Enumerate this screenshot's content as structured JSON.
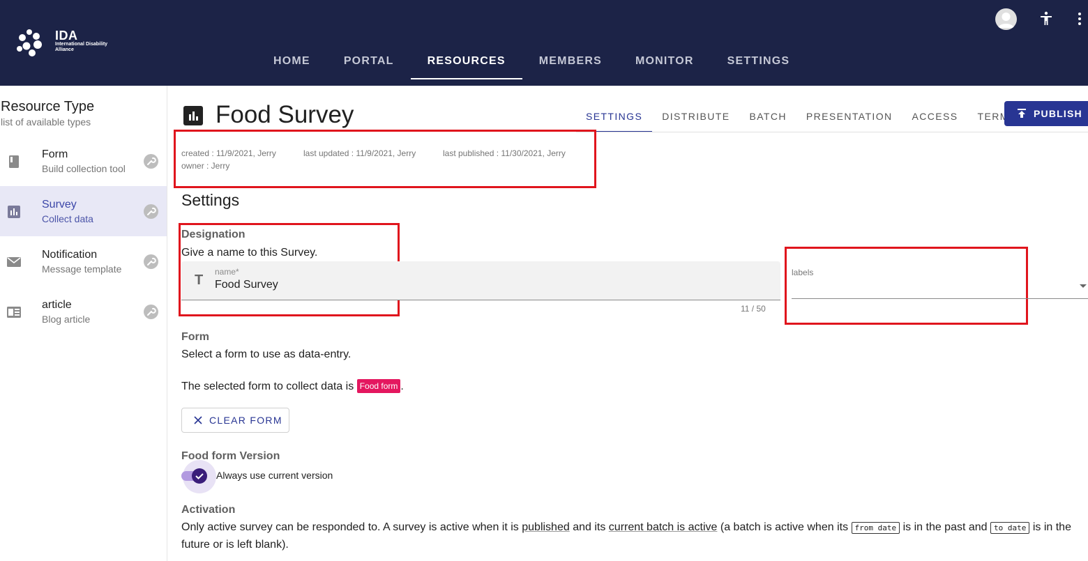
{
  "brand": {
    "name": "IDA",
    "subtitle": "International Disability Alliance"
  },
  "nav": {
    "items": [
      {
        "label": "HOME"
      },
      {
        "label": "PORTAL"
      },
      {
        "label": "RESOURCES"
      },
      {
        "label": "MEMBERS"
      },
      {
        "label": "MONITOR"
      },
      {
        "label": "SETTINGS"
      }
    ],
    "active": "RESOURCES"
  },
  "sidebar": {
    "title": "Resource Type",
    "subtitle": "list of available types",
    "items": [
      {
        "label": "Form",
        "description": "Build collection tool",
        "icon": "book-icon"
      },
      {
        "label": "Survey",
        "description": "Collect data",
        "icon": "bar-chart-icon"
      },
      {
        "label": "Notification",
        "description": "Message template",
        "icon": "envelope-icon"
      },
      {
        "label": "article",
        "description": "Blog article",
        "icon": "article-icon"
      }
    ],
    "active": "Survey"
  },
  "resource": {
    "title": "Food Survey",
    "tabs": [
      {
        "label": "SETTINGS"
      },
      {
        "label": "DISTRIBUTE"
      },
      {
        "label": "BATCH"
      },
      {
        "label": "PRESENTATION"
      },
      {
        "label": "ACCESS"
      },
      {
        "label": "TERMS"
      }
    ],
    "active_tab": "SETTINGS",
    "publish_label": "PUBLISH"
  },
  "meta": {
    "created": "created : 11/9/2021, Jerry",
    "last_updated": "last updated : 11/9/2021, Jerry",
    "last_published": "last published : 11/30/2021, Jerry",
    "owner": "owner : Jerry"
  },
  "settings": {
    "heading": "Settings",
    "designation": {
      "title": "Designation",
      "description": "Give a name to this Survey.",
      "name_label": "name*",
      "name_value": "Food Survey",
      "counter": "11 / 50",
      "labels_label": "labels"
    },
    "form": {
      "title": "Form",
      "description": "Select a form to use as data-entry.",
      "selected_prefix": "The selected form to collect data is",
      "selected_chip": "Food form",
      "selected_suffix": ".",
      "clear_label": "CLEAR FORM"
    },
    "version": {
      "title": "Food form Version",
      "toggle_label": "Always use current version",
      "toggle_on": true
    },
    "activation": {
      "title": "Activation",
      "t1": "Only active survey can be responded to. A survey is active when it is",
      "link1": "published",
      "t2": "and its",
      "link2": "current batch is active",
      "t3": "(a batch is active when its",
      "code1": "from date",
      "t4": "is in the past and",
      "code2": "to date",
      "t5": "is in the future or is left blank)."
    }
  },
  "colors": {
    "header_bg": "#1c2347",
    "accent": "#283593",
    "chip": "#e4175f",
    "highlight_box": "#e0151d",
    "toggle_thumb": "#3a1d7a"
  }
}
